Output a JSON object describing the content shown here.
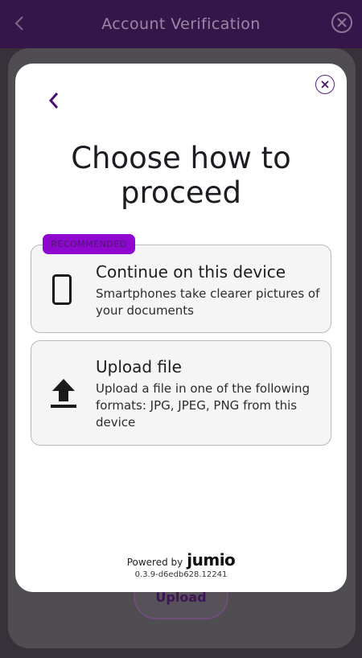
{
  "app": {
    "title": "Account Verification",
    "upload_label": "Upload"
  },
  "modal": {
    "title": "Choose how to proceed",
    "badge": "RECOMMENDED",
    "options": [
      {
        "title": "Continue on this device",
        "description": "Smartphones take clearer pictures of your documents",
        "icon": "smartphone-icon"
      },
      {
        "title": "Upload file",
        "description": "Upload a file in one of the following formats: JPG, JPEG, PNG from this device",
        "icon": "upload-icon"
      }
    ],
    "powered_by": "Powered by",
    "brand": "jumio",
    "version": "0.3.9-d6edb628.12241"
  },
  "colors": {
    "accent": "#5b1e84",
    "badge": "#8e08cf",
    "header_bg": "#36154a"
  }
}
